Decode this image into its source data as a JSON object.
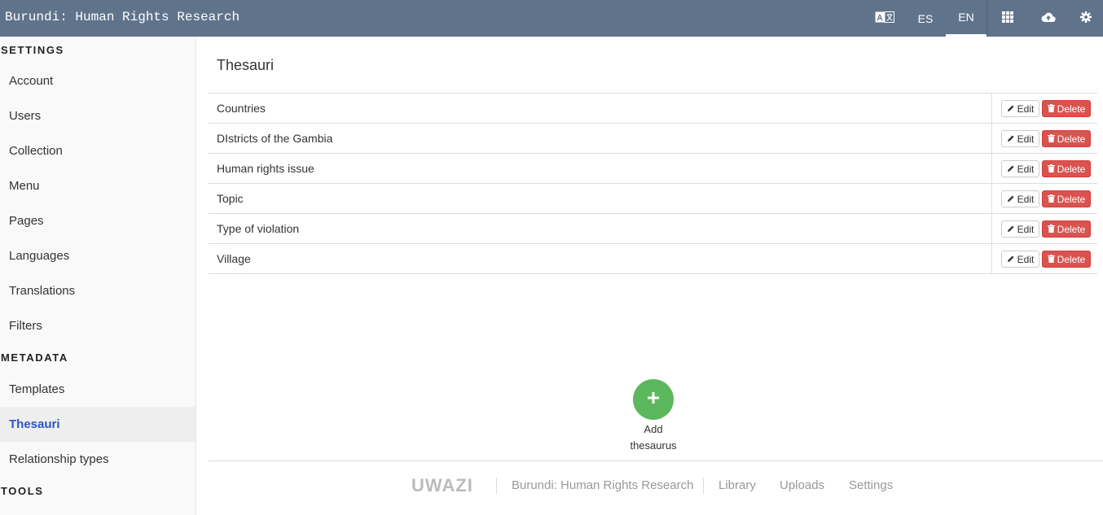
{
  "header": {
    "app_title": "Burundi: Human Rights Research",
    "lang_es": "ES",
    "lang_en": "EN",
    "icons": [
      "translate-icon",
      "grid-icon",
      "cloud-upload-icon",
      "gear-icon"
    ]
  },
  "sidebar": {
    "settings_title": "SETTINGS",
    "settings_items": [
      "Account",
      "Users",
      "Collection",
      "Menu",
      "Pages",
      "Languages",
      "Translations",
      "Filters"
    ],
    "metadata_title": "METADATA",
    "metadata_items": [
      "Templates",
      "Thesauri",
      "Relationship types"
    ],
    "active_item": "Thesauri",
    "tools_title": "TOOLS"
  },
  "main": {
    "title": "Thesauri",
    "edit_label": "Edit",
    "delete_label": "Delete",
    "thesauri": [
      "Countries",
      "DIstricts of the Gambia",
      "Human rights issue",
      "Topic",
      "Type of violation",
      "Village"
    ],
    "add_label_line1": "Add",
    "add_label_line2": "thesaurus"
  },
  "footer": {
    "logo": "UWAZI",
    "site_name": "Burundi: Human Rights Research",
    "links": [
      "Library",
      "Uploads",
      "Settings"
    ]
  },
  "colors": {
    "header_bg": "#5f738b",
    "active_link": "#2b56c6",
    "delete_red": "#d9534f",
    "add_green": "#5cb85c"
  }
}
